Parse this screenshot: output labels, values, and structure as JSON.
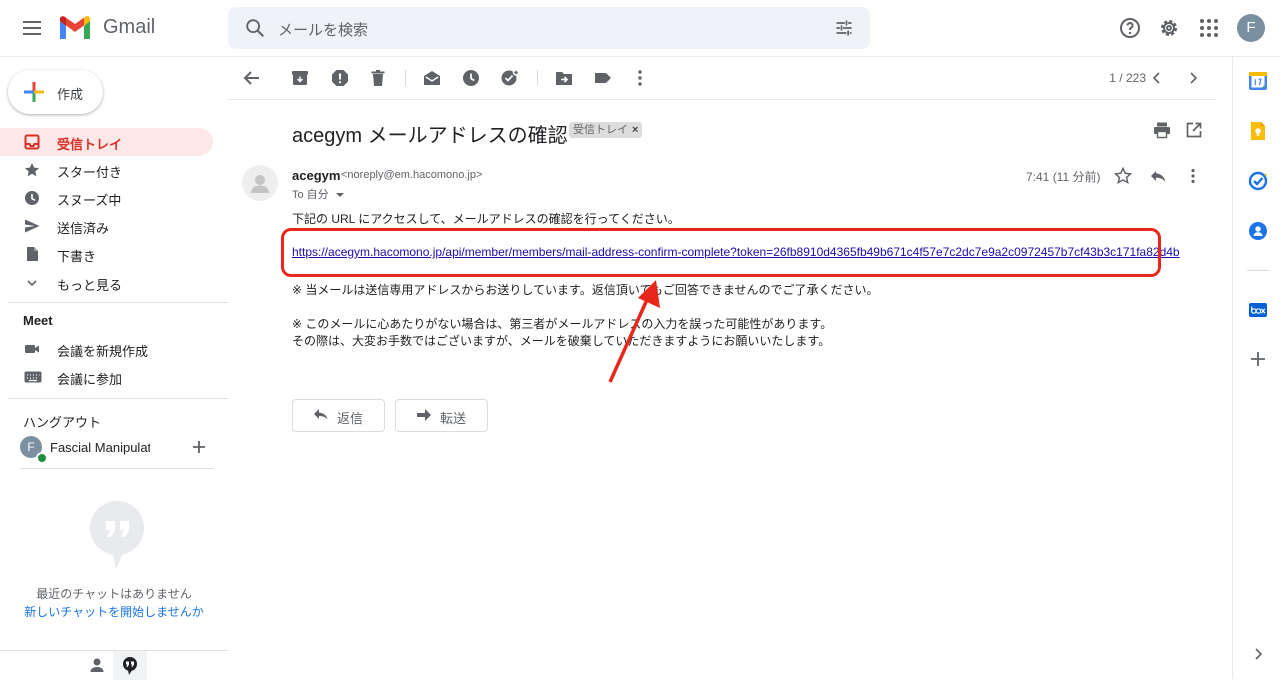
{
  "app": {
    "name": "Gmail"
  },
  "search": {
    "placeholder": "メールを検索"
  },
  "header": {
    "avatar_letter": "F"
  },
  "compose": {
    "label": "作成"
  },
  "sidebar": {
    "items": [
      {
        "label": "受信トレイ"
      },
      {
        "label": "スター付き"
      },
      {
        "label": "スヌーズ中"
      },
      {
        "label": "送信済み"
      },
      {
        "label": "下書き"
      },
      {
        "label": "もっと見る"
      }
    ]
  },
  "meet": {
    "title": "Meet",
    "items": [
      {
        "label": "会議を新規作成"
      },
      {
        "label": "会議に参加"
      }
    ]
  },
  "hangouts": {
    "title": "ハングアウト",
    "user_initial": "F",
    "user_name": "Fascial Manipulation",
    "empty_text": "最近のチャットはありません",
    "start_link": "新しいチャットを開始しませんか"
  },
  "toolbar": {
    "pager": "1 / 223"
  },
  "message": {
    "subject": "acegym メールアドレスの確認",
    "label_chip": "受信トレイ",
    "label_chip_close": "×",
    "sender_name": "acegym",
    "sender_email": "<noreply@em.hacomono.jp>",
    "to": "To 自分",
    "time": "7:41 (11 分前)",
    "intro": "下記の URL にアクセスして、メールアドレスの確認を行ってください。",
    "link": "https://acegym.hacomono.jp/api/member/members/mail-address-confirm-complete?token=26fb8910d4365fb49b671c4f57e7c2dc7e9a2c0972457b7cf43b3c171fa82d4b",
    "note1": "※ 当メールは送信専用アドレスからお送りしています。返信頂いてもご回答できませんのでご了承ください。",
    "note2": "※ このメールに心あたりがない場合は、第三者がメールアドレスの入力を誤った可能性があります。",
    "note3": "その際は、大変お手数ではございますが、メールを破棄していただきますようにお願いいたします。"
  },
  "actions": {
    "reply": "返信",
    "forward": "転送"
  },
  "colors": {
    "accent_red": "#d93025",
    "annotation_red": "#e8271a",
    "link": "#1a0dab",
    "active_bg": "#fce8e6"
  }
}
